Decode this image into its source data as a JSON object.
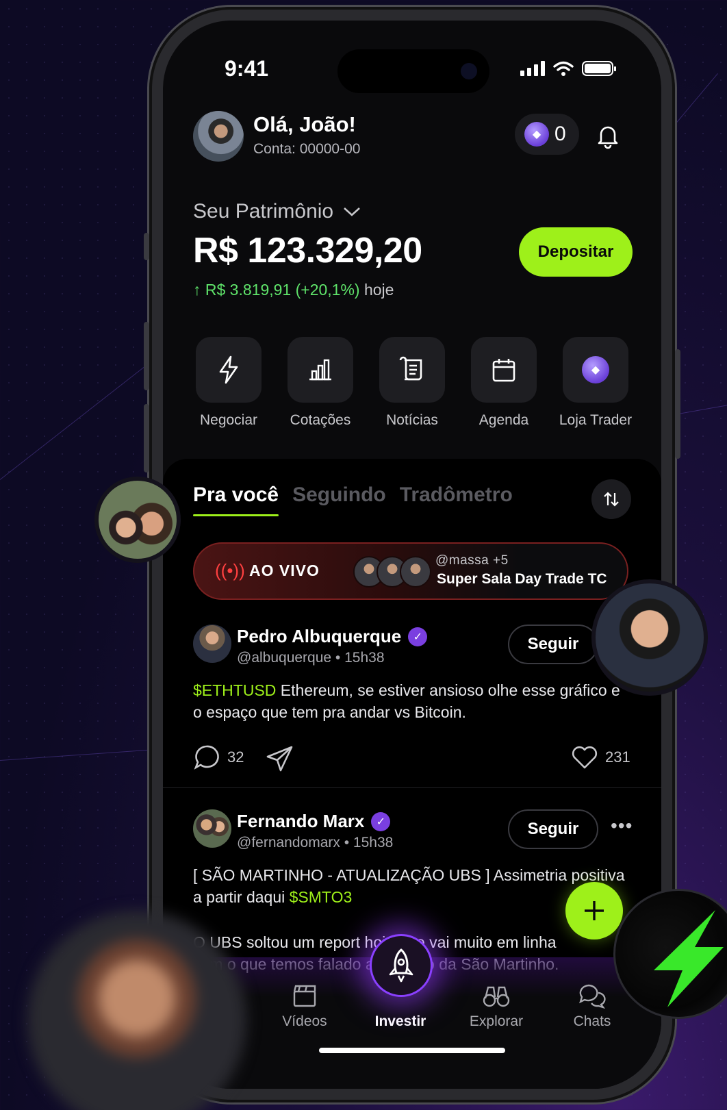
{
  "status_bar": {
    "time": "9:41"
  },
  "header": {
    "greeting": "Olá, João!",
    "account": "Conta: 00000-00",
    "coins": "0"
  },
  "wealth": {
    "label": "Seu Patrimônio",
    "balance": "R$ 123.329,20",
    "change": "↑ R$ 3.819,91 (+20,1%)",
    "change_suffix": "hoje",
    "deposit_label": "Depositar"
  },
  "quick_actions": [
    {
      "label": "Negociar",
      "icon": "lightning-icon"
    },
    {
      "label": "Cotações",
      "icon": "bar-chart-icon"
    },
    {
      "label": "Notícias",
      "icon": "scroll-icon"
    },
    {
      "label": "Agenda",
      "icon": "calendar-icon"
    },
    {
      "label": "Loja Trader",
      "icon": "coin-icon"
    }
  ],
  "feed": {
    "tabs": [
      "Pra você",
      "Seguindo",
      "Tradômetro"
    ],
    "active_tab": "Pra você",
    "live": {
      "label": "AO VIVO",
      "users": "@massa +5",
      "room": "Super Sala Day Trade TC"
    },
    "posts": [
      {
        "name": "Pedro Albuquerque",
        "handle": "@albuquerque",
        "time": "15h38",
        "follow_label": "Seguir",
        "ticker": "$ETHTUSD",
        "text": " Ethereum, se estiver ansioso olhe esse gráfico e o espaço que tem pra andar vs Bitcoin.",
        "comments": "32",
        "likes": "231"
      },
      {
        "name": "Fernando Marx",
        "handle": "@fernandomarx",
        "time": "15h38",
        "follow_label": "Seguir",
        "text_before": "[ SÃO MARTINHO - ATUALIZAÇÃO UBS ] Assimetria positiva a partir daqui ",
        "ticker": "$SMTO3",
        "text2": "O UBS soltou um report hoje que vai muito em linha com o que temos falado a respeito da São Martinho."
      }
    ]
  },
  "bottom_nav": [
    {
      "label": "Vídeos",
      "icon": "clapperboard-icon"
    },
    {
      "label": "Investir",
      "icon": "rocket-icon",
      "active": true
    },
    {
      "label": "Explorar",
      "icon": "binoculars-icon"
    },
    {
      "label": "Chats",
      "icon": "chat-bubbles-icon"
    }
  ],
  "colors": {
    "accent": "#9ef01a",
    "positive": "#5fe36a",
    "verified": "#7a3fe0",
    "live": "#ff4040"
  }
}
